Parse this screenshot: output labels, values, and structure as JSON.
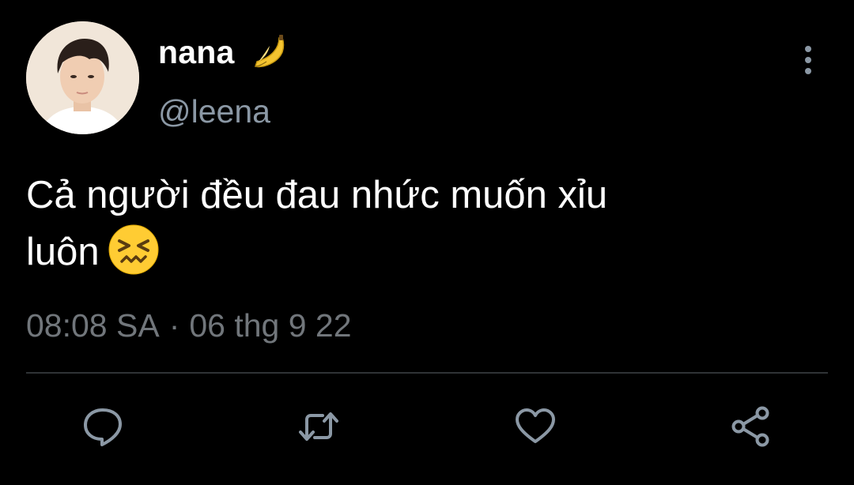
{
  "tweet": {
    "display_name": "nana",
    "handle": "@leena",
    "text_line1": "Cả người đều đau nhức muốn xỉu",
    "text_line2": "luôn",
    "time": "08:08 SA",
    "separator": "·",
    "date": "06 thg 9 22"
  },
  "icons": {
    "name_emoji": "banana-icon",
    "text_emoji": "persevering-face-emoji",
    "actions": [
      "reply-icon",
      "retweet-icon",
      "like-icon",
      "share-icon"
    ],
    "menu": "more-vertical-icon"
  },
  "colors": {
    "background": "#000000",
    "primary_text": "#ffffff",
    "secondary_text": "#8b98a5",
    "divider": "#2f3336"
  }
}
